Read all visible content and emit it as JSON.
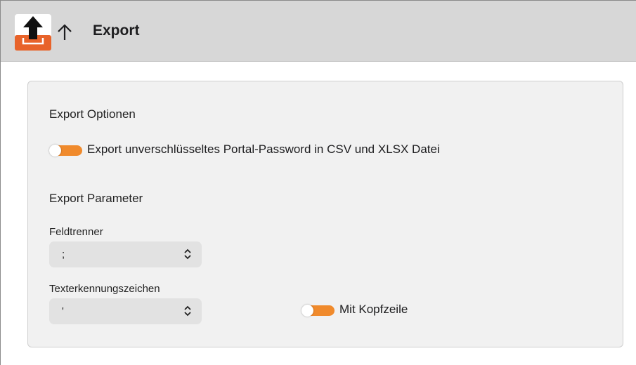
{
  "toolbar": {
    "title": "Export",
    "app_icon": "export-app-icon",
    "nav_icon": "arrow-up-icon"
  },
  "options": {
    "heading": "Export Optionen",
    "unencrypted_toggle_label": "Export unverschlüsseltes Portal-Password in CSV und XLSX Datei",
    "unencrypted_toggle_on": true
  },
  "parameters": {
    "heading": "Export Parameter",
    "field_separator_label": "Feldtrenner",
    "field_separator_value": ";",
    "text_qualifier_label": "Texterkennungszeichen",
    "text_qualifier_value": "'",
    "header_row_toggle_label": "Mit Kopfzeile",
    "header_row_toggle_on": true
  },
  "colors": {
    "toggle_accent": "#f08a2c",
    "app_icon_orange": "#e8632a"
  }
}
